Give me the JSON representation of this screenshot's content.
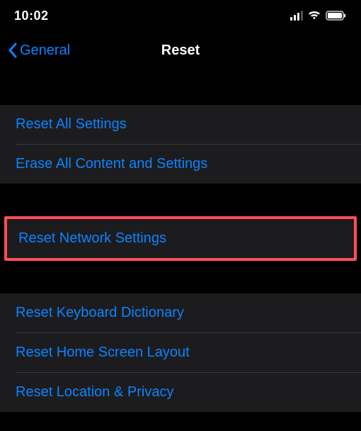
{
  "status_bar": {
    "time": "10:02"
  },
  "nav": {
    "back_label": "General",
    "title": "Reset"
  },
  "groups": [
    {
      "items": [
        {
          "label": "Reset All Settings"
        },
        {
          "label": "Erase All Content and Settings"
        }
      ]
    },
    {
      "highlighted": true,
      "items": [
        {
          "label": "Reset Network Settings"
        }
      ]
    },
    {
      "items": [
        {
          "label": "Reset Keyboard Dictionary"
        },
        {
          "label": "Reset Home Screen Layout"
        },
        {
          "label": "Reset Location & Privacy"
        }
      ]
    }
  ]
}
